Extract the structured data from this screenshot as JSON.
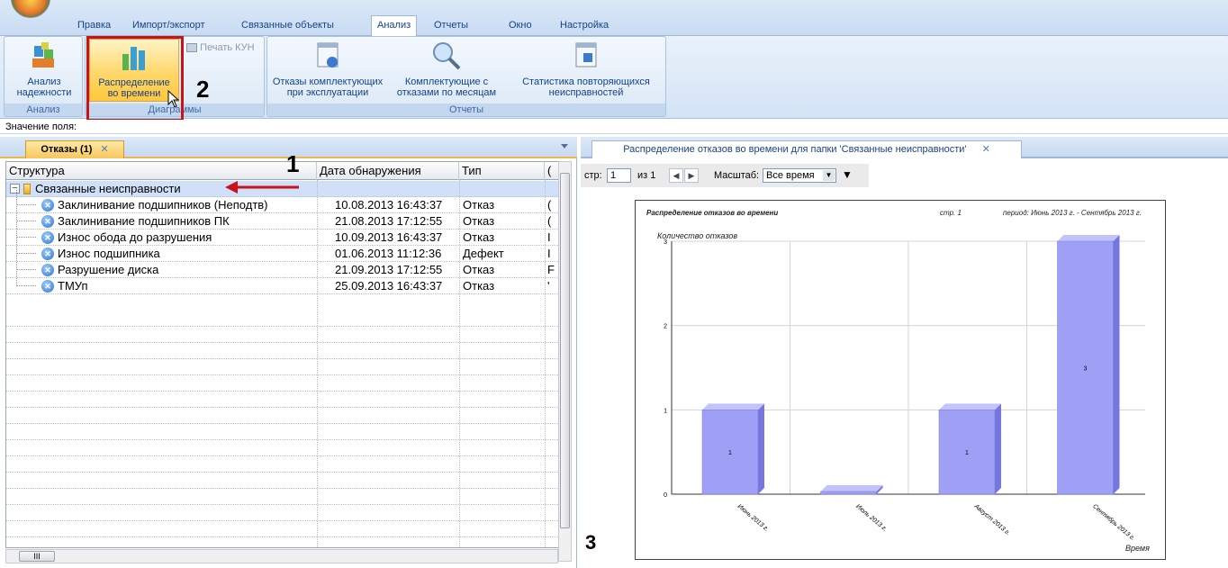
{
  "menu": {
    "tabs": [
      "Правка",
      "Импорт/экспорт",
      "Связанные объекты",
      "Анализ",
      "Отчеты",
      "Окно",
      "Настройка"
    ],
    "active_tab": "Анализ"
  },
  "ribbon": {
    "btn_reliability": "Анализ надежности",
    "btn_reliability_1": "Анализ",
    "btn_reliability_2": "надежности",
    "btn_time_1": "Распределение",
    "btn_time_2": "во времени",
    "btn_print": "Печать КУН",
    "btn_components_1": "Отказы комплектующих",
    "btn_components_2": "при эксплуатации",
    "btn_monthly_1": "Комплектующие с",
    "btn_monthly_2": "отказами по месяцам",
    "btn_repeat_1": "Статистика повторяющихся",
    "btn_repeat_2": "неисправностей",
    "group_analysis": "Анализ",
    "group_charts": "Диаграммы",
    "group_reports": "Отчеты"
  },
  "field_value_label": "Значение поля:",
  "left_panel": {
    "tab_label": "Отказы (1)",
    "columns": [
      "Структура",
      "Дата обнаружения",
      "Тип",
      "("
    ],
    "folder": "Связанные неисправности",
    "rows": [
      {
        "name": "Заклинивание подшипников (Неподтв)",
        "date": "10.08.2013 16:43:37",
        "type": "Отказ",
        "extra": "("
      },
      {
        "name": "Заклинивание подшипников ПК",
        "date": "21.08.2013 17:12:55",
        "type": "Отказ",
        "extra": "("
      },
      {
        "name": "Износ обода до разрушения",
        "date": "10.09.2013 16:43:37",
        "type": "Отказ",
        "extra": "I"
      },
      {
        "name": "Износ подшипника",
        "date": "01.06.2013 11:12:36",
        "type": "Дефект",
        "extra": "I"
      },
      {
        "name": "Разрушение диска",
        "date": "21.09.2013 17:12:55",
        "type": "Отказ",
        "extra": "F"
      },
      {
        "name": "ТМУп",
        "date": "25.09.2013 16:43:37",
        "type": "Отказ",
        "extra": "'"
      }
    ]
  },
  "markers": {
    "m1": "1",
    "m2": "2",
    "m3": "3"
  },
  "right_panel": {
    "tab_label": "Распределение отказов во времени для папки 'Связанные неисправности'",
    "page_label": "стр:",
    "page_value": "1",
    "of_label": "из 1",
    "scale_label": "Масштаб:",
    "scale_value": "Все время"
  },
  "report": {
    "title": "Распределение отказов во времени",
    "page": "стр. 1",
    "period": "период:   Июнь 2013 г. - Сентябрь 2013 г."
  },
  "chart_data": {
    "type": "bar",
    "ylabel": "Количество отказов",
    "xlabel": "Время",
    "categories": [
      "Июнь 2013 г.",
      "Июль 2013 г.",
      "Август 2013 г.",
      "Сентябрь 2013 г."
    ],
    "values": [
      1,
      0,
      1,
      3
    ],
    "data_labels": [
      "1",
      "",
      "1",
      "3"
    ],
    "yticks": [
      "0",
      "1",
      "2",
      "3"
    ],
    "ylim": [
      0,
      3
    ],
    "grid": true,
    "bar_color": "#9f9ff5"
  }
}
